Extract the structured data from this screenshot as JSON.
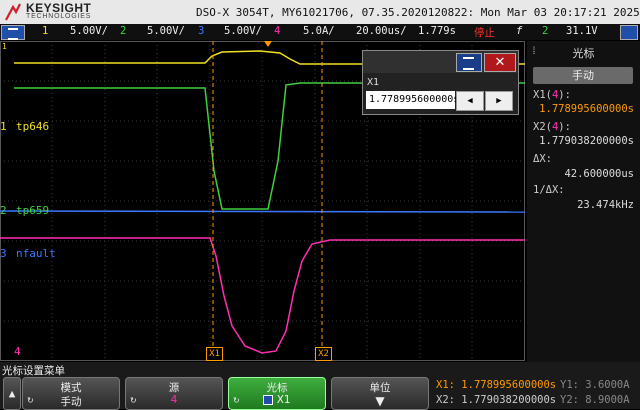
{
  "header": {
    "brand": "KEYSIGHT",
    "brand_sub": "TECHNOLOGIES",
    "model_line": "DSO-X 3054T, MY61021706, 07.35.2020120822: Mon Mar 03 20:17:21 2025"
  },
  "channel_bar": {
    "ch1_num": "1",
    "ch1_scale": "5.00V/",
    "ch2_num": "2",
    "ch2_scale": "5.00V/",
    "ch3_num": "3",
    "ch3_scale": "5.00V/",
    "ch4_num": "4",
    "ch4_scale": "5.0A/",
    "timebase": "20.00us/",
    "delay": "1.779s",
    "run_state": "停止",
    "trig_slope": "f",
    "trig_ch": "2",
    "trig_level": "31.1V"
  },
  "colors": {
    "ch1": "#f0e020",
    "ch2": "#40d040",
    "ch3": "#3c78ff",
    "ch4": "#ff2fb0",
    "cursor": "#ff9a00"
  },
  "waveform_labels": {
    "ch1": "tp646",
    "ch2": "tp659",
    "ch3": "nfault",
    "ch4_marker": "4",
    "ch1_marker": "1",
    "ch2_marker": "2",
    "ch3_marker": "3"
  },
  "cursor_markers": {
    "x1": "X1",
    "x2": "X2"
  },
  "right_panel": {
    "title": "光标",
    "mode": "手动",
    "x1_label": "X1(",
    "x1_ch": "4",
    "x1_suffix": "):",
    "x1_value": "1.778995600000s",
    "x2_label": "X2(",
    "x2_ch": "4",
    "x2_suffix": "):",
    "x2_value": "1.779038200000s",
    "dx_label": "ΔX:",
    "dx_value": "42.600000us",
    "inv_dx_label": "1/ΔX:",
    "inv_dx_value": "23.474kHz"
  },
  "popup": {
    "title": "X1",
    "value": "1.778995600000s",
    "close": "✕"
  },
  "softkeys": {
    "menu_title": "光标设置菜单",
    "mode_label": "模式",
    "mode_value": "手动",
    "source_label": "源",
    "source_value": "4",
    "cursor_label": "光标",
    "cursor_value": "X1",
    "units_label": "单位"
  },
  "readout": {
    "x1_label": "X1:",
    "x1_value": "1.778995600000s",
    "x2_label": "X2:",
    "x2_value": "1.779038200000s",
    "y1_label": "Y1:",
    "y1_value": "3.6000A",
    "y2_label": "Y2:",
    "y2_value": "8.9000A"
  }
}
